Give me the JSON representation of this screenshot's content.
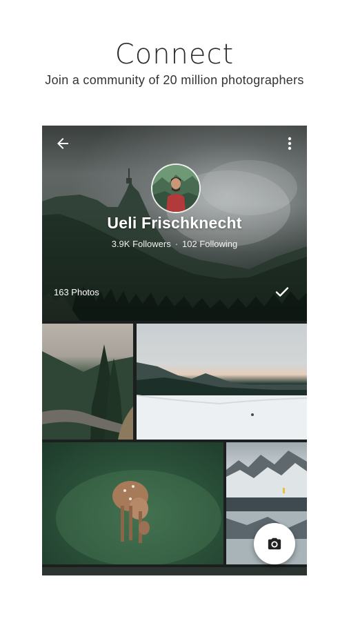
{
  "promo": {
    "headline": "Connect",
    "subheadline": "Join a community of 20 million photographers"
  },
  "profile": {
    "name": "Ueli Frischknecht",
    "followers": "3.9K Followers",
    "separator": "·",
    "following": "102 Following",
    "photos_count": "163 Photos"
  },
  "icons": {
    "back": "arrow-left-icon",
    "more": "more-vertical-icon",
    "follow": "check-icon",
    "camera": "camera-icon"
  },
  "colors": {
    "page_background": "#ffffff",
    "headline_text": "#2a2a2a",
    "overlay_text": "#ffffff",
    "fab_background": "#ffffff"
  }
}
